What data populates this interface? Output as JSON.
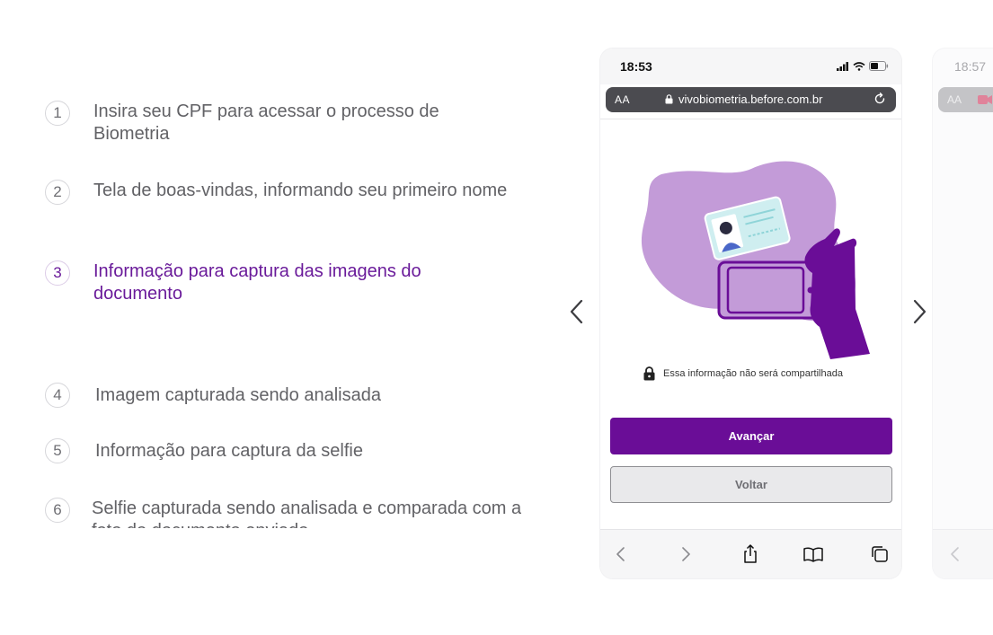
{
  "steps": [
    {
      "number": "1",
      "text": "Insira seu CPF para acessar o processo de Biometria",
      "active": false
    },
    {
      "number": "2",
      "text": "Tela de boas-vindas, informando seu primeiro nome",
      "active": false
    },
    {
      "number": "3",
      "text": "Informação para captura das imagens do documento",
      "active": true
    },
    {
      "number": "4",
      "text": "Imagem capturada sendo analisada",
      "active": false
    },
    {
      "number": "5",
      "text": "Informação para captura da selfie",
      "active": false
    },
    {
      "number": "6",
      "text": "Selfie capturada sendo analisada e comparada com a foto do documento enviado",
      "active": false
    }
  ],
  "carousel": {
    "prev_icon": "chevron-left-icon",
    "next_icon": "chevron-right-icon"
  },
  "phone": {
    "time": "18:53",
    "aa_label": "AA",
    "url": "vivobiometria.before.com.br",
    "notice": "Essa informação não será compartilhada",
    "primary_button": "Avançar",
    "secondary_button": "Voltar",
    "toolbar_icons": [
      "back-icon",
      "forward-icon",
      "share-icon",
      "bookmarks-icon",
      "tabs-icon"
    ]
  },
  "phone2": {
    "time": "18:57",
    "aa_label": "AA"
  },
  "colors": {
    "accent": "#6a0d97",
    "illustration_blob": "#c39bd8",
    "text": "#626266"
  }
}
